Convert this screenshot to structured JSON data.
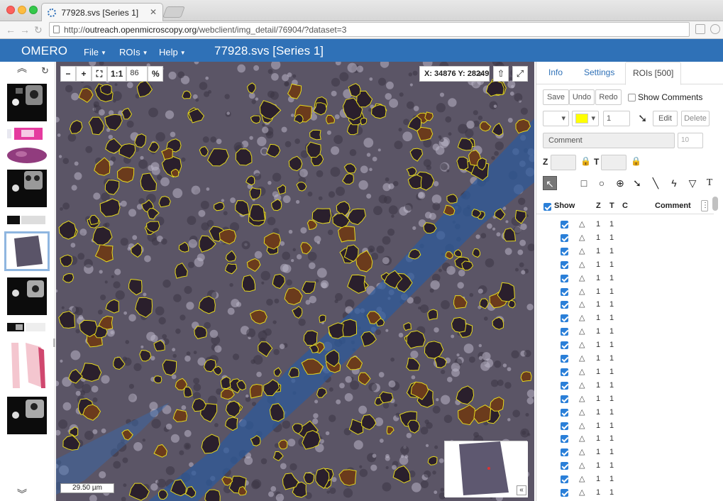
{
  "browser": {
    "tab_title": "77928.svs [Series 1]",
    "url_prefix": "http://",
    "url_host": "outreach.openmicroscopy.org",
    "url_path": "/webclient/img_detail/76904/?dataset=3"
  },
  "navbar": {
    "brand": "OMERO",
    "menus": [
      "File",
      "ROIs",
      "Help"
    ],
    "title": "77928.svs [Series 1]",
    "color": "#2f71b7"
  },
  "viewer": {
    "zoom_out": "−",
    "zoom_in": "+",
    "fit_icon": "fit-to-window-icon",
    "one_to_one": "1:1",
    "zoom_value": "86",
    "zoom_unit": "%",
    "coords": "X: 34876 Y: 28249",
    "scalebar": "29.50 µm",
    "collapse_birdseye": "«"
  },
  "right_panel": {
    "tabs": [
      "Info",
      "Settings",
      "ROIs [500]"
    ],
    "save": "Save",
    "undo": "Undo",
    "redo": "Redo",
    "show_comments": "Show Comments",
    "line_width": "1",
    "edit": "Edit",
    "delete": "Delete",
    "comment_placeholder": "Comment",
    "font_size": "10",
    "z_label": "Z",
    "t_label": "T",
    "fill_color": "#ffff00",
    "table": {
      "show": "Show",
      "z": "Z",
      "t": "T",
      "c": "C",
      "comment": "Comment"
    },
    "rows": [
      {
        "z": "1",
        "t": "1"
      },
      {
        "z": "1",
        "t": "1"
      },
      {
        "z": "1",
        "t": "1"
      },
      {
        "z": "1",
        "t": "1"
      },
      {
        "z": "1",
        "t": "1"
      },
      {
        "z": "1",
        "t": "1"
      },
      {
        "z": "1",
        "t": "1"
      },
      {
        "z": "1",
        "t": "1"
      },
      {
        "z": "1",
        "t": "1"
      },
      {
        "z": "1",
        "t": "1"
      },
      {
        "z": "1",
        "t": "1"
      },
      {
        "z": "1",
        "t": "1"
      },
      {
        "z": "1",
        "t": "1"
      },
      {
        "z": "1",
        "t": "1"
      },
      {
        "z": "1",
        "t": "1"
      },
      {
        "z": "1",
        "t": "1"
      },
      {
        "z": "1",
        "t": "1"
      },
      {
        "z": "1",
        "t": "1"
      },
      {
        "z": "1",
        "t": "1"
      },
      {
        "z": "1",
        "t": "1"
      },
      {
        "z": "1",
        "t": "1"
      }
    ]
  }
}
